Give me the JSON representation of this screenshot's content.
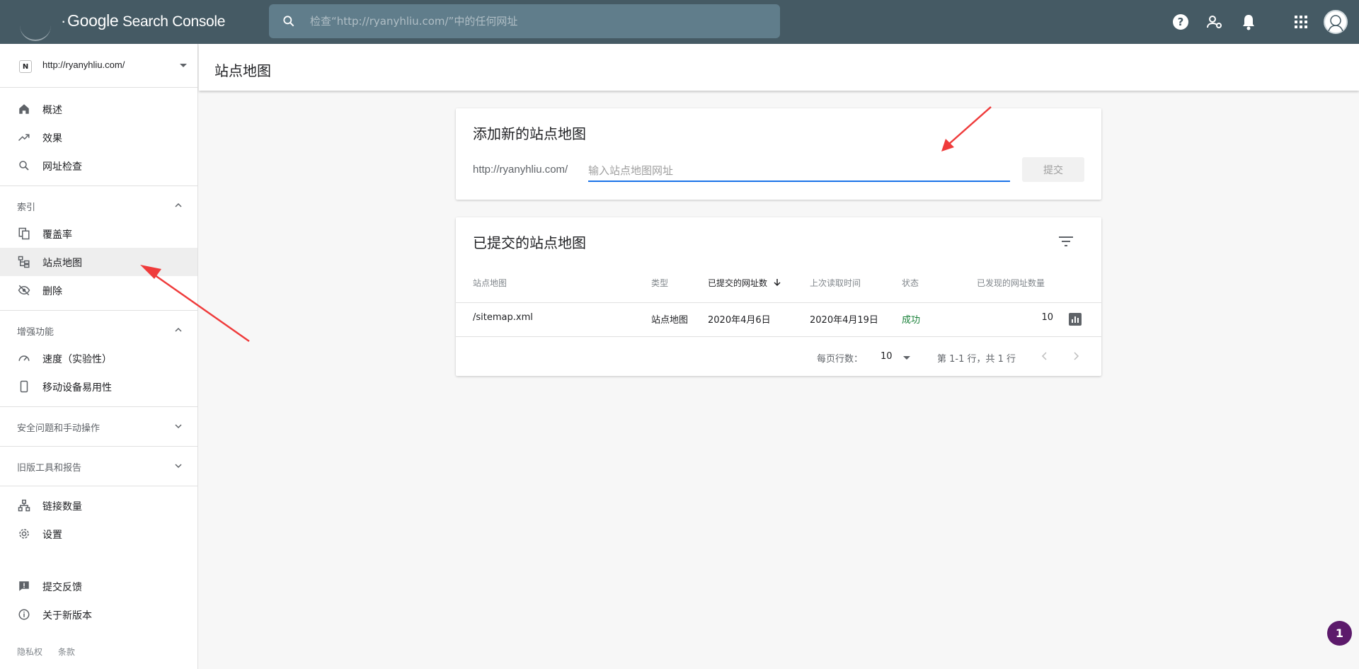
{
  "topbar": {
    "brand_google": "Google",
    "brand_product": "Search Console",
    "search_placeholder": "检查“http://ryanyhliu.com/”中的任何网址"
  },
  "sidebar": {
    "property": "http://ryanyhliu.com/",
    "property_icon_letter": "N",
    "main_items": [
      {
        "label": "概述",
        "icon": "home-icon"
      },
      {
        "label": "效果",
        "icon": "trending-up-icon"
      },
      {
        "label": "网址检查",
        "icon": "search-icon"
      }
    ],
    "index_section": "索引",
    "index_items": [
      {
        "label": "覆盖率",
        "icon": "copy-pages-icon"
      },
      {
        "label": "站点地图",
        "icon": "sitemap-icon"
      },
      {
        "label": "删除",
        "icon": "eye-off-icon"
      }
    ],
    "enhance_section": "增强功能",
    "enhance_items": [
      {
        "label": "速度（实验性）",
        "icon": "speedometer-icon"
      },
      {
        "label": "移动设备易用性",
        "icon": "phone-icon"
      }
    ],
    "security_section": "安全问题和手动操作",
    "legacy_section": "旧版工具和报告",
    "other_items": [
      {
        "label": "链接数量",
        "icon": "network-icon"
      },
      {
        "label": "设置",
        "icon": "gear-icon"
      }
    ],
    "bottom_items": [
      {
        "label": "提交反馈",
        "icon": "feedback-icon"
      },
      {
        "label": "关于新版本",
        "icon": "info-icon"
      }
    ],
    "footer": {
      "privacy": "隐私权",
      "terms": "条款"
    }
  },
  "page": {
    "title": "站点地图"
  },
  "add_card": {
    "title": "添加新的站点地图",
    "prefix": "http://ryanyhliu.com/",
    "input_placeholder": "输入站点地图网址",
    "submit_label": "提交"
  },
  "submitted_card": {
    "title": "已提交的站点地图",
    "columns": [
      "站点地图",
      "类型",
      "已提交的网址数",
      "上次读取时间",
      "状态",
      "已发现的网址数量"
    ],
    "rows": [
      {
        "sitemap": "/sitemap.xml",
        "type": "站点地图",
        "submitted": "2020年4月6日",
        "last_read": "2020年4月19日",
        "status": "成功",
        "discovered": "10"
      }
    ],
    "pager": {
      "rows_label": "每页行数：",
      "rows_value": "10",
      "range": "第 1-1 行，共 1 行"
    }
  },
  "badge": "1",
  "colors": {
    "topbar": "#455a64",
    "search": "#607d8b",
    "accent": "#1a73e8",
    "success": "#188038",
    "annotation": "#ef3b3b",
    "badge": "#5c1a6b"
  }
}
